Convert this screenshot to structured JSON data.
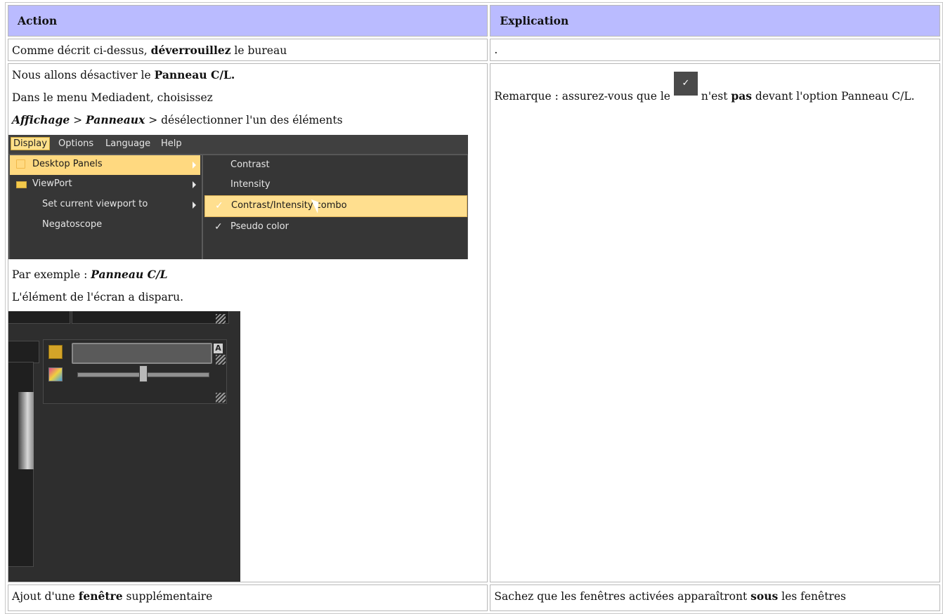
{
  "header": {
    "col1": "Action",
    "col2": "Explication"
  },
  "row1": {
    "text_pre": "Comme décrit ci-dessus, ",
    "text_bold": "déverrouillez",
    "text_post": " le bureau",
    "col2": "."
  },
  "row2": {
    "line1_pre": "Nous allons désactiver le ",
    "line1_bold": "Panneau C/L.",
    "line2": "Dans le menu Mediadent, choisissez",
    "path_1": "Affichage",
    "path_sep1": " > ",
    "path_2": "Panneaux",
    "path_sep2": " > ",
    "path_rest": "désélectionner l'un des éléments",
    "example_pre": "Par exemple : ",
    "example_bold": "Panneau C/L",
    "disappeared": "L'élément de l'écran a disparu.",
    "note_pre": "Remarque : assurez-vous que le ",
    "note_mid": " n'est ",
    "note_bold": "pas",
    "note_post": " devant l'option Panneau C/L."
  },
  "menu": {
    "bar": [
      "Display",
      "Options",
      "Language",
      "Help"
    ],
    "items": [
      "Desktop Panels",
      "ViewPort",
      "Set current viewport to",
      "Negatoscope"
    ],
    "submenu": [
      "Contrast",
      "Intensity",
      "Contrast/Intensity combo",
      "Pseudo color"
    ],
    "check_glyph": "✓"
  },
  "panel": {
    "a_label": "A"
  },
  "row3": {
    "col1_pre": "Ajout d'une ",
    "col1_bold": "fenêtre",
    "col1_post": " supplémentaire",
    "col2_pre": "Sachez que les fenêtres activées apparaîtront ",
    "col2_bold": "sous",
    "col2_post": " les fenêtres"
  }
}
